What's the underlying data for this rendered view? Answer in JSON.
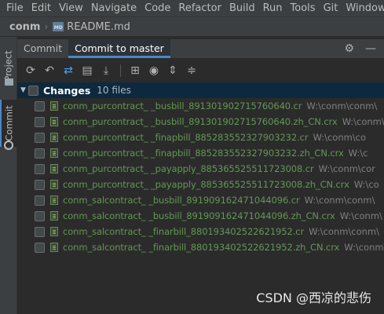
{
  "menubar": {
    "items": [
      "File",
      "Edit",
      "View",
      "Navigate",
      "Code",
      "Refactor",
      "Build",
      "Run",
      "Tools",
      "Git",
      "Window"
    ]
  },
  "navbar": {
    "project": "conm",
    "separator": "›",
    "file_badge": "MD",
    "file": "README.md"
  },
  "side_tabs": {
    "project": "Project",
    "commit": "Commit"
  },
  "tabs": {
    "items": [
      "Commit",
      "Commit to master"
    ],
    "active": "Commit to master"
  },
  "tab_tools": {
    "settings_icon": "⚙",
    "minimize_icon": "—"
  },
  "toolbar": {
    "icons": [
      "refresh-icon",
      "rollback-icon",
      "show-diff-icon",
      "changelist-icon",
      "update-icon",
      "group-by-icon",
      "view-options-icon",
      "expand-all-icon",
      "collapse-all-icon"
    ]
  },
  "changes": {
    "label": "Changes",
    "count": "10 files"
  },
  "files": [
    {
      "name": "conm_purcontract_ _busbill_891301902715760640.cr",
      "path": "W:\\conm\\conm\\"
    },
    {
      "name": "conm_purcontract_ _busbill_891301902715760640.zh_CN.crx",
      "path": "W:\\conm\\"
    },
    {
      "name": "conm_purcontract_ _finapbill_885283552327903232.cr",
      "path": "W:\\conm\\co"
    },
    {
      "name": "conm_purcontract_ _finapbill_885283552327903232.zh_CN.crx",
      "path": "W:\\c"
    },
    {
      "name": "conm_purcontract_ _payapply_885365525511723008.cr",
      "path": "W:\\conm\\cor"
    },
    {
      "name": "conm_purcontract_ _payapply_885365525511723008.zh_CN.crx",
      "path": "W:\\co"
    },
    {
      "name": "conm_salcontract_ _busbill_891909162471044096.cr",
      "path": "W:\\conm\\conm\\"
    },
    {
      "name": "conm_salcontract_ _busbill_891909162471044096.zh_CN.crx",
      "path": "W:\\conm\\"
    },
    {
      "name": "conm_salcontract_ _finarbill_880193402522621952.cr",
      "path": "W:\\conm\\conm\\"
    },
    {
      "name": "conm_salcontract_ _finarbill_880193402522621952.zh_CN.crx",
      "path": "W:\\conm\\"
    }
  ],
  "watermark": "CSDN @西凉的悲伤",
  "colors": {
    "background": "#2b2b2b",
    "chrome": "#3c3f41",
    "accent": "#4a88c7",
    "selection": "#0d293e",
    "added_file": "#629755"
  }
}
